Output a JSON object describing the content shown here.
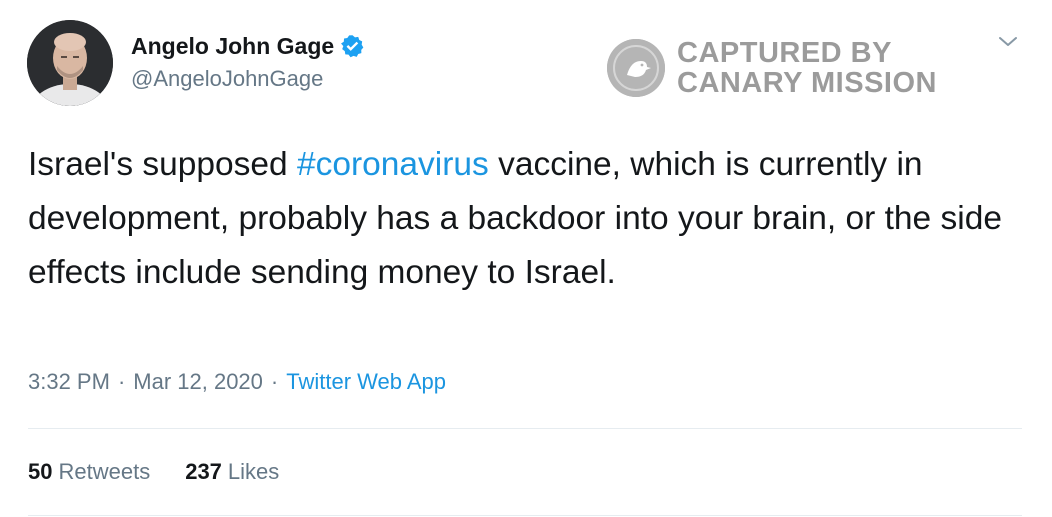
{
  "author": {
    "name": "Angelo John Gage",
    "handle": "@AngeloJohnGage",
    "verified": true
  },
  "watermark": {
    "line1": "CAPTURED BY",
    "line2": "CANARY MISSION"
  },
  "tweet": {
    "text_before": "Israel's supposed ",
    "hashtag": "#coronavirus",
    "text_after": " vaccine, which is currently in development, probably has a backdoor into your brain, or the side effects include sending money to Israel.",
    "time": "3:32 PM",
    "separator": "·",
    "date": "Mar 12, 2020",
    "source": "Twitter Web App"
  },
  "stats": {
    "retweets_count": "50",
    "retweets_label": "Retweets",
    "likes_count": "237",
    "likes_label": "Likes"
  },
  "icons": {
    "verified": "verified-badge-icon",
    "menu": "chevron-down-icon",
    "seal": "canary-seal-icon"
  },
  "colors": {
    "link": "#1b95e0",
    "secondary_text": "#657786",
    "primary_text": "#14171a",
    "verified": "#1da1f2",
    "watermark": "#9b9b9b"
  }
}
